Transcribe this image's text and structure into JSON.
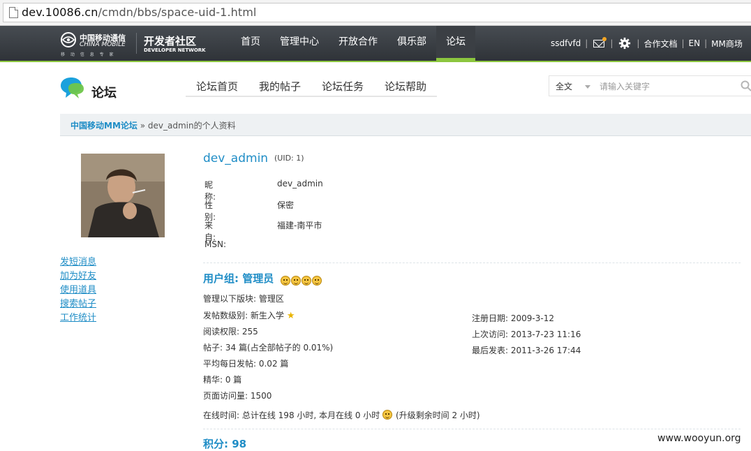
{
  "browser": {
    "url_host": "dev.10086.cn",
    "url_path": "/cmdn/bbs/space-uid-1.html"
  },
  "topnav": {
    "logo_cn": "中国移动通信",
    "logo_en": "CHINA MOBILE",
    "logo_sub": "移 动 信 息 专 家",
    "dev_cn": "开发者社区",
    "dev_en": "DEVELOPER NETWORK",
    "items": [
      {
        "label": "首页"
      },
      {
        "label": "管理中心"
      },
      {
        "label": "开放合作"
      },
      {
        "label": "俱乐部"
      },
      {
        "label": "论坛"
      }
    ],
    "active": "论坛",
    "user": "ssdfvfd",
    "sep": "|",
    "docs": "合作文档",
    "lang": "EN",
    "mm": "MM商场",
    "icons": [
      "mail-icon",
      "gear-icon"
    ],
    "accent": "#8cc63f"
  },
  "forum": {
    "title": "论坛",
    "subnav": [
      {
        "label": "论坛首页"
      },
      {
        "label": "我的帖子"
      },
      {
        "label": "论坛任务"
      },
      {
        "label": "论坛帮助"
      }
    ],
    "search_scope": "全文",
    "search_placeholder": "请输入关键字"
  },
  "breadcrumb": {
    "home": "中国移动MM论坛",
    "sep": "»",
    "current": "dev_admin的个人资料"
  },
  "sidebar": {
    "links": [
      {
        "label": "发短消息"
      },
      {
        "label": "加为好友"
      },
      {
        "label": "使用道具"
      },
      {
        "label": "搜索帖子"
      },
      {
        "label": "工作统计"
      }
    ]
  },
  "profile": {
    "username": "dev_admin",
    "uid": "(UID: 1)",
    "fields": [
      {
        "k": "昵称:",
        "v": "dev_admin"
      },
      {
        "k": "性别:",
        "v": "保密"
      },
      {
        "k": "来自:",
        "v": "福建-南平市"
      },
      {
        "k": "MSN:",
        "v": ""
      }
    ],
    "group_title": "用户组: 管理员",
    "manage_line": "管理以下版块: 管理区",
    "post_level": "发帖数级别: 新生入学",
    "read_perm": "阅读权限: 255",
    "posts": "帖子: 34 篇(占全部帖子的 0.01%)",
    "daily": "平均每日发帖: 0.02 篇",
    "digest": "精华: 0 篇",
    "views": "页面访问量: 1500",
    "online": "在线时间: 总计在线 198 小时, 本月在线 0 小时",
    "upgrade": "(升级剩余时间 2 小时)",
    "reg_date": "注册日期: 2009-3-12",
    "last_visit": "上次访问: 2013-7-23 11:16",
    "last_post": "最后发表: 2011-3-26 17:44",
    "score": "积分: 98"
  },
  "watermark": "www.wooyun.org",
  "colors": {
    "link": "#1f8dc6",
    "nav_bg": "#3a3e43"
  }
}
